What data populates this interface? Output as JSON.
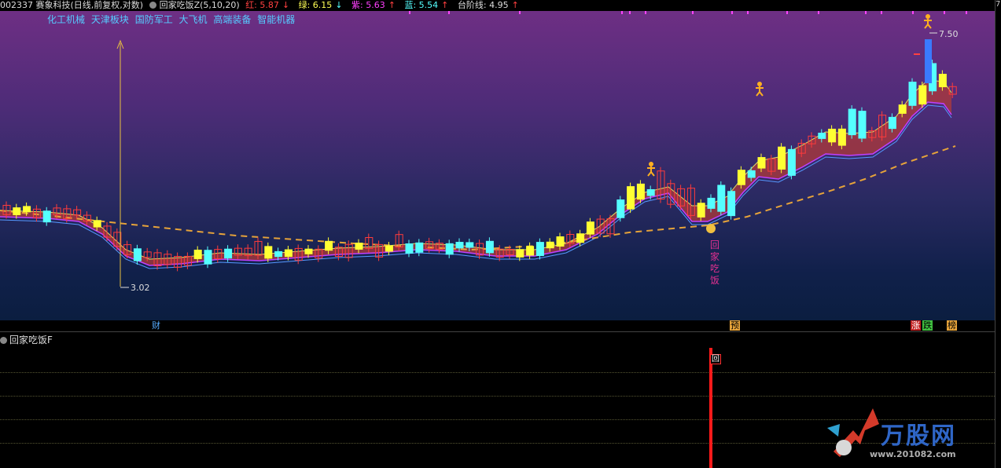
{
  "header": {
    "title": "002337 赛象科技(日线,前复权,对数)",
    "indicator_name": "回家吃饭Z(5,10,20)",
    "red_label": "红: 5.87",
    "red_arrow": "↓",
    "green_label": "绿: 6.15",
    "green_arrow": "↓",
    "purple_label": "紫: 5.63",
    "purple_arrow": "↑",
    "blue_label": "蓝: 5.54",
    "blue_arrow": "↑",
    "step_label": "台阶线: 4.95",
    "step_arrow": "↑"
  },
  "sectors": [
    "化工机械",
    "天津板块",
    "国防军工",
    "大飞机",
    "高端装备",
    "智能机器"
  ],
  "price_labels": {
    "low": "3.02",
    "high": "7.50"
  },
  "vertical_signal_text": "回家吃饭",
  "date_marks": [
    "财",
    "预",
    "涨",
    "跌",
    "榜"
  ],
  "sub_panel": {
    "title": "回家吃饭F",
    "signal_char": "回"
  },
  "right_axis": {
    "top_value": "7"
  },
  "watermark": {
    "brand": "万股网",
    "url": "www.201082.com"
  },
  "colors": {
    "up_candle": "#ff3b3b",
    "down_candle": "#55ffff",
    "yellow_candle": "#ffff33",
    "magenta_candle": "#ff44ff",
    "step_line": "#e6a33a",
    "ma_fill_up": "#b03a3a",
    "ma_fill_down": "#2f7a2f"
  }
}
